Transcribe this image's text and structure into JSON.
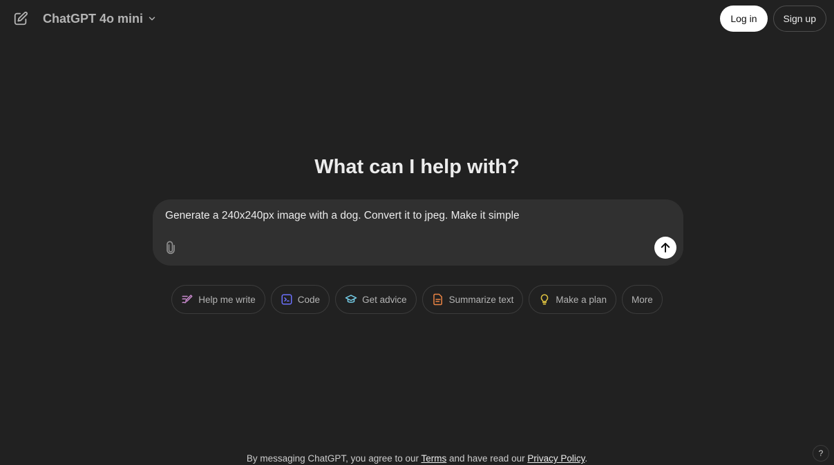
{
  "header": {
    "model_name": "ChatGPT 4o mini",
    "login_label": "Log in",
    "signup_label": "Sign up",
    "icons": {
      "new_chat": "edit-icon",
      "model_dropdown": "chevron-down-icon"
    }
  },
  "main": {
    "heading": "What can I help with?",
    "composer": {
      "value": "Generate a 240x240px image with a dog. Convert it to jpeg. Make it simple",
      "attach_icon": "paperclip-icon",
      "send_icon": "arrow-up-icon"
    },
    "chips": [
      {
        "label": "Help me write",
        "icon": "pen-icon",
        "color": "#cb8bd0"
      },
      {
        "label": "Code",
        "icon": "terminal-icon",
        "color": "#6c71ff"
      },
      {
        "label": "Get advice",
        "icon": "graduation-cap-icon",
        "color": "#76d0eb"
      },
      {
        "label": "Summarize text",
        "icon": "document-icon",
        "color": "#ea8444"
      },
      {
        "label": "Make a plan",
        "icon": "lightbulb-icon",
        "color": "#e2c541"
      },
      {
        "label": "More",
        "icon": "",
        "color": ""
      }
    ]
  },
  "footer": {
    "prefix": "By messaging ChatGPT, you agree to our ",
    "terms": "Terms",
    "middle": " and have read our ",
    "privacy": "Privacy Policy",
    "suffix": ".",
    "help": "?"
  },
  "colors": {
    "background": "#212121",
    "composer": "#303030",
    "text": "#ececec",
    "muted": "#b4b4b4"
  }
}
